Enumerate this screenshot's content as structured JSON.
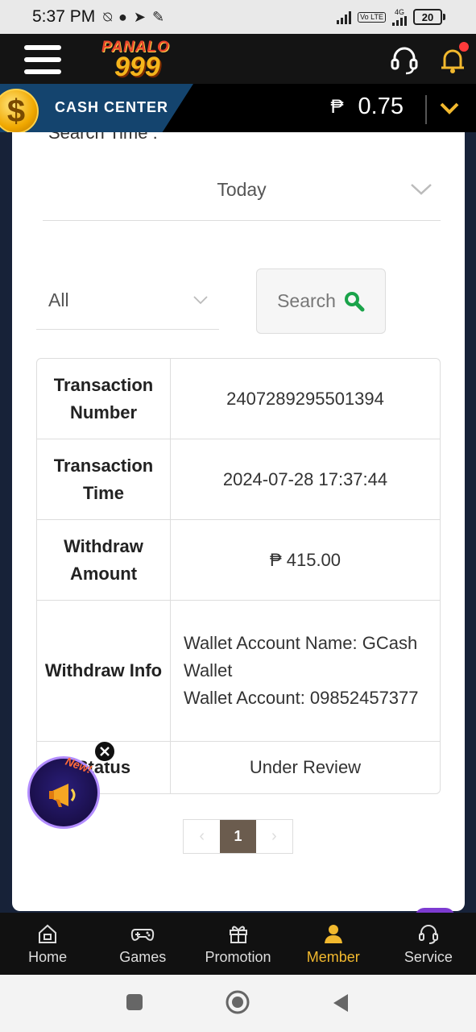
{
  "status_bar": {
    "time": "5:37 PM",
    "battery": "20",
    "network": "4G",
    "volte": "Vo LTE"
  },
  "header": {
    "logo_top": "PANALO",
    "logo_number": "999",
    "icons": [
      "menu-icon",
      "headset-icon",
      "bell-icon"
    ]
  },
  "cash_center": {
    "label": "CASH CENTER",
    "currency": "₱",
    "balance": "0.75"
  },
  "filters": {
    "search_time_label": "Search Time :",
    "date_value": "Today",
    "type_value": "All",
    "search_button": "Search"
  },
  "detail": {
    "rows": [
      {
        "label": "Transaction Number",
        "value": "2407289295501394"
      },
      {
        "label": "Transaction Time",
        "value": "2024-07-28 17:37:44"
      },
      {
        "label": "Withdraw Amount",
        "value": "₱ 415.00"
      },
      {
        "label": "Withdraw Info",
        "value": "Wallet Account Name: GCash Wallet\nWallet Account: 09852457377"
      },
      {
        "label": "Status",
        "value": "Under Review"
      }
    ]
  },
  "pagination": {
    "current_page": "1"
  },
  "promo": {
    "badge": "New!"
  },
  "bottom_nav": [
    {
      "label": "Home",
      "icon": "home-icon",
      "active": false
    },
    {
      "label": "Games",
      "icon": "gamepad-icon",
      "active": false
    },
    {
      "label": "Promotion",
      "icon": "gift-icon",
      "active": false
    },
    {
      "label": "Member",
      "icon": "person-icon",
      "active": true
    },
    {
      "label": "Service",
      "icon": "headset-icon",
      "active": false
    }
  ],
  "colors": {
    "accent": "#f2b92e",
    "cash_tab": "#14446e",
    "page_active": "#6b5c4e"
  }
}
